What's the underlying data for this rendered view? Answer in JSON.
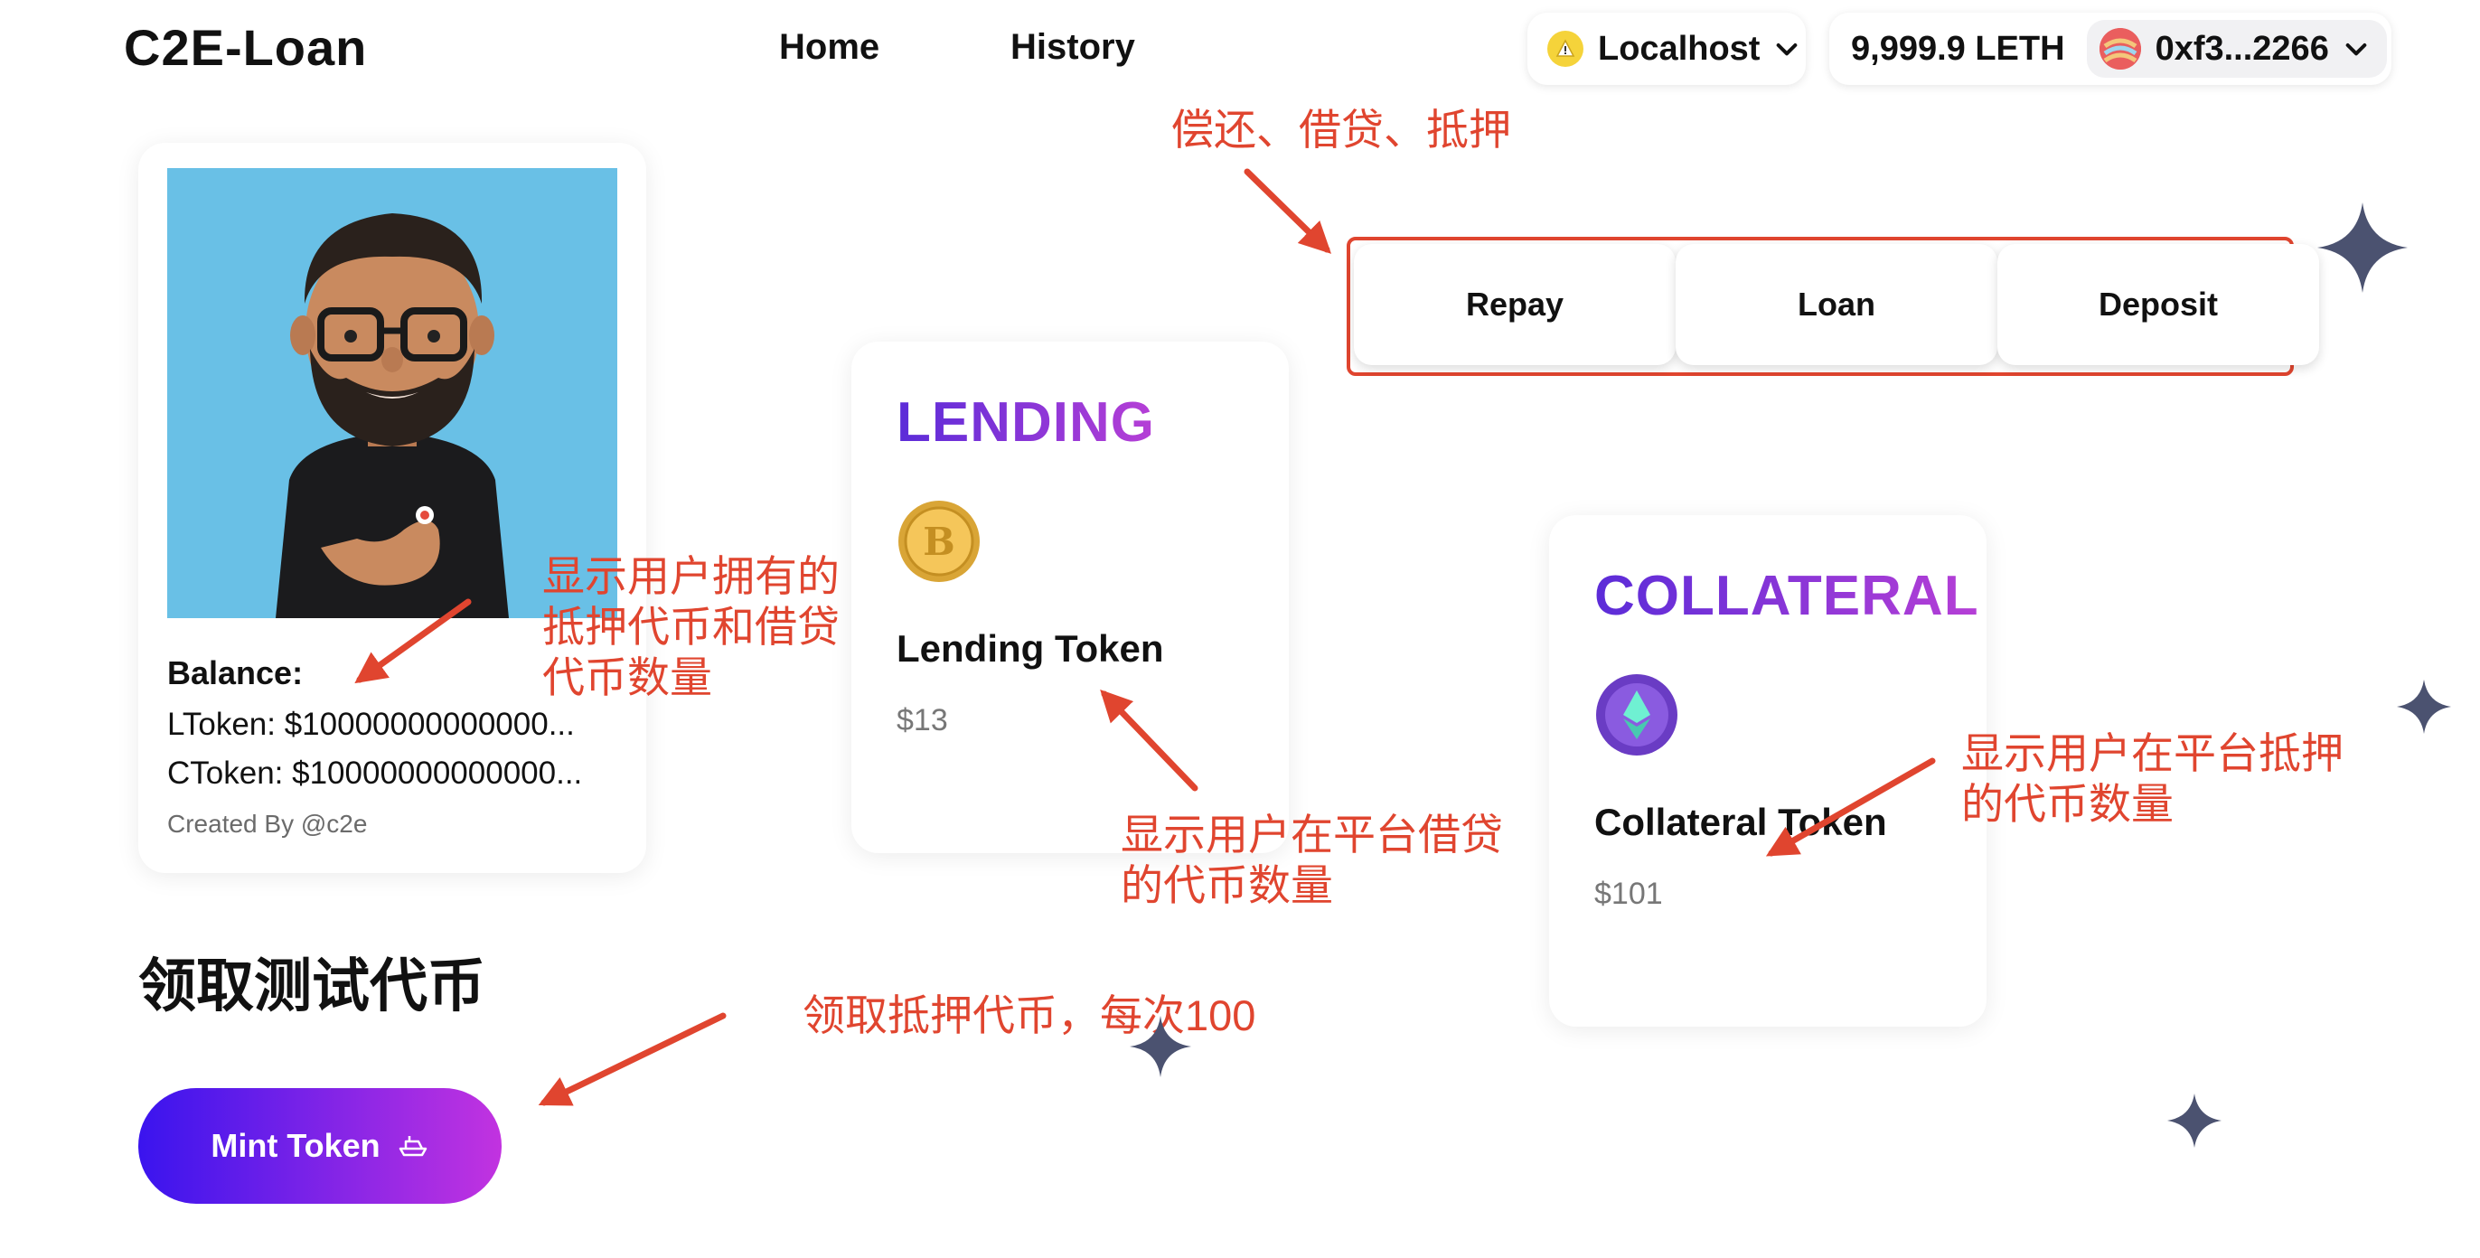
{
  "header": {
    "logo": "C2E-Loan",
    "nav": [
      "Home",
      "History"
    ],
    "network": "Localhost",
    "balance": "9,999.9 LETH",
    "address": "0xf3...2266"
  },
  "profile": {
    "balance_title": "Balance:",
    "ltoken": "LToken: $10000000000000...",
    "ctoken": "CToken: $10000000000000...",
    "created_by": "Created By @c2e"
  },
  "actions": {
    "repay": "Repay",
    "loan": "Loan",
    "deposit": "Deposit"
  },
  "lending": {
    "title": "LENDING",
    "token_name": "Lending Token",
    "price": "$13"
  },
  "collateral": {
    "title": "COLLATERAL",
    "token_name": "Collateral Token",
    "price": "$101"
  },
  "mint": {
    "heading": "领取测试代币",
    "button": "Mint Token"
  },
  "annotations": {
    "actions": "偿还、借贷、抵押",
    "profile": [
      "显示用户拥有的",
      "抵押代币和借贷",
      "代币数量"
    ],
    "lending": [
      "显示用户在平台借贷",
      "的代币数量"
    ],
    "collateral": [
      "显示用户在平台抵押",
      "的代币数量"
    ],
    "mint": "领取抵押代币，每次100"
  },
  "colors": {
    "annotation": "#e0452f",
    "title_gradient_start": "#5b2cd8",
    "title_gradient_end": "#b63fd6",
    "mint_gradient_start": "#3a14ee",
    "mint_gradient_end": "#c233e0",
    "sparkle": "#4b5270"
  },
  "icons": [
    "net-icon",
    "chevron-down-icon",
    "avatar-icon",
    "bitcoin-coin-icon",
    "ethereum-coin-icon",
    "ship-icon",
    "sparkle-icon"
  ]
}
